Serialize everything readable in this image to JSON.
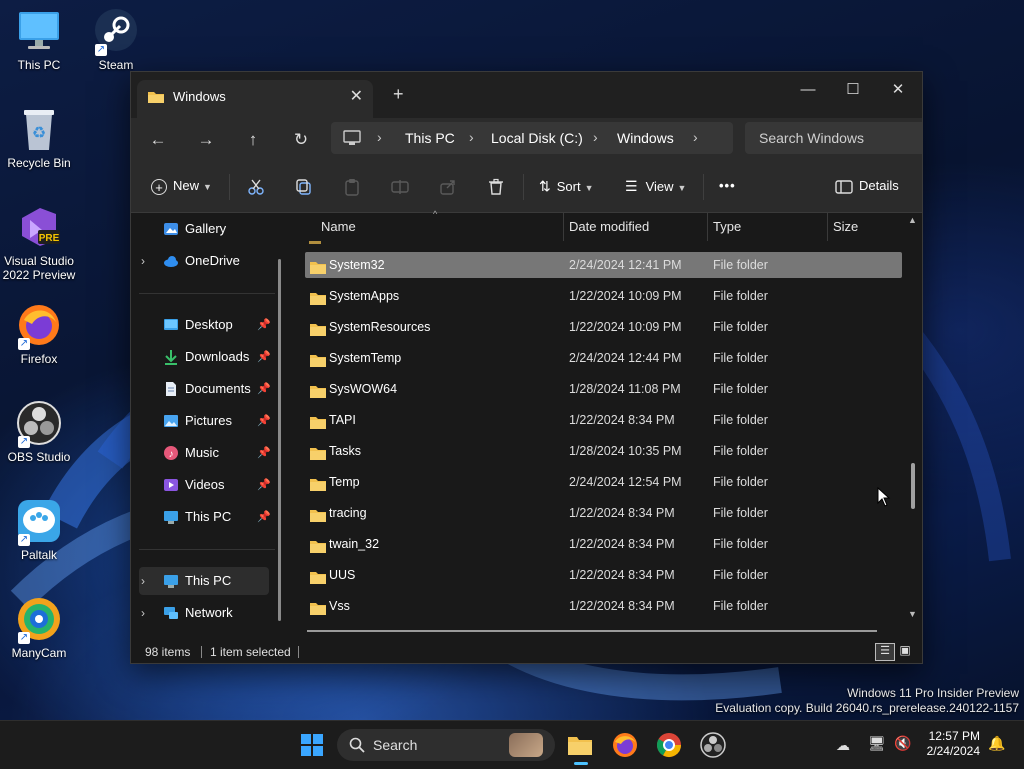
{
  "desktop": {
    "icons": [
      {
        "label": "This PC"
      },
      {
        "label": "Steam"
      },
      {
        "label": "Recycle Bin"
      },
      {
        "label": "Visual Studio 2022 Preview",
        "badge": "PRE"
      },
      {
        "label": "Firefox"
      },
      {
        "label": "OBS Studio"
      },
      {
        "label": "Paltalk"
      },
      {
        "label": "ManyCam"
      }
    ],
    "watermark": {
      "line1": "Windows 11 Pro Insider Preview",
      "line2": "Evaluation copy. Build 26040.rs_prerelease.240122-1157"
    }
  },
  "explorer": {
    "tab_title": "Windows",
    "breadcrumb": [
      "This PC",
      "Local Disk (C:)",
      "Windows"
    ],
    "search_placeholder": "Search Windows",
    "toolbar": {
      "new_label": "New",
      "sort_label": "Sort",
      "view_label": "View",
      "more_label": "•••",
      "details_label": "Details"
    },
    "sidebar": {
      "items": [
        {
          "label": "Gallery",
          "icon": "gallery-icon"
        },
        {
          "label": "OneDrive",
          "icon": "cloud-icon"
        },
        {
          "label": "Desktop",
          "icon": "desktop-icon"
        },
        {
          "label": "Downloads",
          "icon": "download-icon"
        },
        {
          "label": "Documents",
          "icon": "documents-icon"
        },
        {
          "label": "Pictures",
          "icon": "pictures-icon"
        },
        {
          "label": "Music",
          "icon": "music-icon"
        },
        {
          "label": "Videos",
          "icon": "videos-icon"
        },
        {
          "label": "This PC",
          "icon": "pc-icon"
        },
        {
          "label": "This PC",
          "icon": "pc-icon"
        },
        {
          "label": "Network",
          "icon": "network-icon"
        }
      ]
    },
    "columns": {
      "name": "Name",
      "date": "Date modified",
      "type": "Type",
      "size": "Size"
    },
    "files": [
      {
        "name": "System32",
        "date": "2/24/2024 12:41 PM",
        "type": "File folder",
        "selected": true
      },
      {
        "name": "SystemApps",
        "date": "1/22/2024 10:09 PM",
        "type": "File folder"
      },
      {
        "name": "SystemResources",
        "date": "1/22/2024 10:09 PM",
        "type": "File folder"
      },
      {
        "name": "SystemTemp",
        "date": "2/24/2024 12:44 PM",
        "type": "File folder"
      },
      {
        "name": "SysWOW64",
        "date": "1/28/2024 11:08 PM",
        "type": "File folder"
      },
      {
        "name": "TAPI",
        "date": "1/22/2024 8:34 PM",
        "type": "File folder"
      },
      {
        "name": "Tasks",
        "date": "1/28/2024 10:35 PM",
        "type": "File folder"
      },
      {
        "name": "Temp",
        "date": "2/24/2024 12:54 PM",
        "type": "File folder"
      },
      {
        "name": "tracing",
        "date": "1/22/2024 8:34 PM",
        "type": "File folder"
      },
      {
        "name": "twain_32",
        "date": "1/22/2024 8:34 PM",
        "type": "File folder"
      },
      {
        "name": "UUS",
        "date": "1/22/2024 8:34 PM",
        "type": "File folder"
      },
      {
        "name": "Vss",
        "date": "1/22/2024 8:34 PM",
        "type": "File folder"
      }
    ],
    "status": {
      "count": "98 items",
      "selection": "1 item selected"
    }
  },
  "taskbar": {
    "search_label": "Search",
    "time": "12:57 PM",
    "date": "2/24/2024"
  },
  "colors": {
    "folder": "#f2c14e",
    "accent": "#4cc2ff",
    "selection": "#777777"
  }
}
